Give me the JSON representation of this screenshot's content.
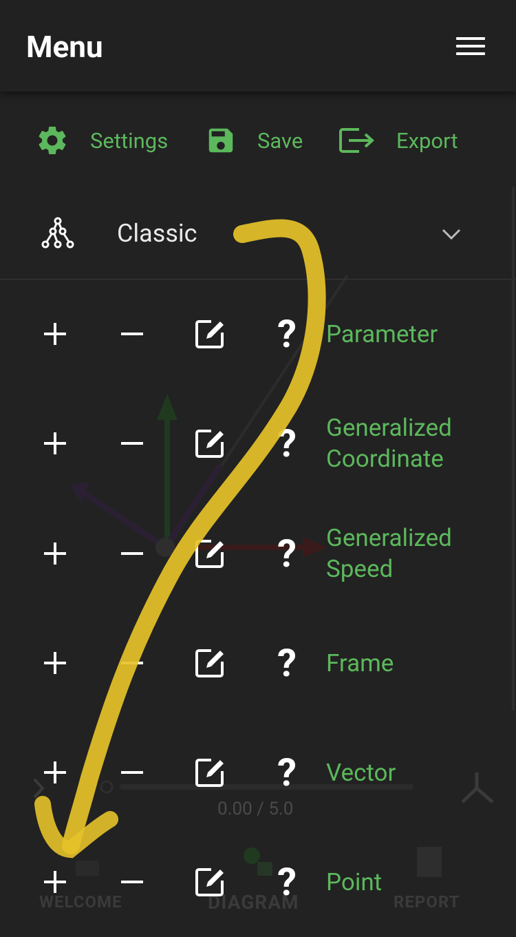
{
  "header": {
    "title": "Menu",
    "menu_icon": "hamburger-icon"
  },
  "toolbar": {
    "settings_label": "Settings",
    "save_label": "Save",
    "export_label": "Export"
  },
  "dropdown": {
    "selected": "Classic",
    "icon": "tree-icon"
  },
  "rows": [
    {
      "label_line1": "Parameter",
      "label_line2": ""
    },
    {
      "label_line1": "Generalized",
      "label_line2": "Coordinate"
    },
    {
      "label_line1": "Generalized",
      "label_line2": "Speed"
    },
    {
      "label_line1": "Frame",
      "label_line2": ""
    },
    {
      "label_line1": "Vector",
      "label_line2": ""
    },
    {
      "label_line1": "Point",
      "label_line2": ""
    }
  ],
  "row_actions": {
    "help_symbol": "?"
  },
  "background": {
    "time_display": "0.00 / 5.0",
    "nav": {
      "welcome": "WELCOME",
      "diagram": "DIAGRAM",
      "report": "REPORT"
    }
  },
  "colors": {
    "accent": "#5cb85c",
    "background": "#222222",
    "header": "#212121",
    "highlight": "#e6c229"
  }
}
